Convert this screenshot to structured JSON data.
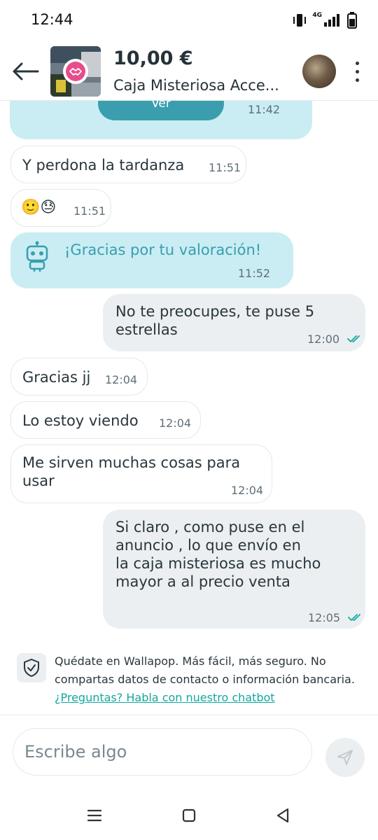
{
  "status_bar": {
    "time": "12:44",
    "network": "4G"
  },
  "header": {
    "price": "10,00 €",
    "title": "Caja Misteriosa Acce...",
    "icons": {
      "back": "arrow-left-icon",
      "menu": "more-vertical-icon",
      "badge": "handshake-icon"
    }
  },
  "colors": {
    "bot_bubble": "#c9edf3",
    "ver_button": "#3a9eae",
    "outgoing_bubble": "#eceff1",
    "link": "#13a89e",
    "read_check": "#13a89e"
  },
  "messages": {
    "ver": {
      "button_label": "Ver",
      "time": "11:42"
    },
    "m1": {
      "text": "Y perdona la tardanza",
      "time": "11:51"
    },
    "m2": {
      "emoji": "🙂😓",
      "time": "11:51"
    },
    "bot": {
      "text": "¡Gracias por tu valoración!",
      "time": "11:52",
      "icon": "robot-icon"
    },
    "m3": {
      "line1": "No te preocupes, te puse 5",
      "line2": "estrellas",
      "time": "12:00"
    },
    "m4": {
      "text": "Gracias jj",
      "time": "12:04"
    },
    "m5": {
      "text": "Lo estoy viendo",
      "time": "12:04"
    },
    "m6": {
      "line1": "Me sirven muchas cosas para",
      "line2": "usar",
      "time": "12:04"
    },
    "m7": {
      "line1": "Si claro , como puse en el",
      "line2": "anuncio , lo que envío en",
      "line3": "la caja misteriosa es mucho",
      "line4": "mayor a al precio venta",
      "time": "12:05"
    }
  },
  "notice": {
    "text": "Quédate en Wallapop. Más fácil, más seguro. No compartas datos de contacto o información bancaria. ",
    "link": "¿Preguntas? Habla con nuestro chatbot",
    "icon": "shield-check-icon"
  },
  "composer": {
    "placeholder": "Escribe algo",
    "send_icon": "send-icon"
  }
}
